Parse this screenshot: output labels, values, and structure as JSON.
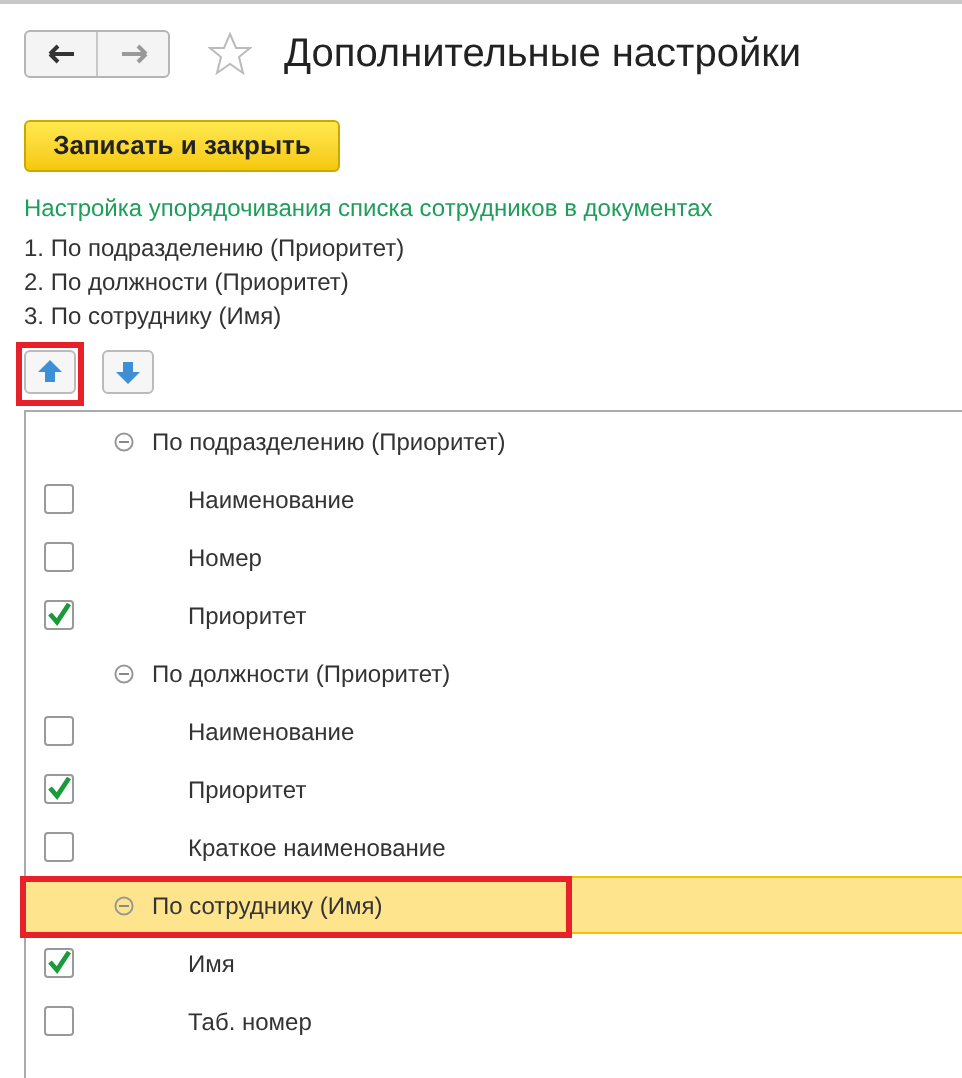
{
  "window": {
    "title": "Дополнительные настройки",
    "favorite": false
  },
  "toolbar": {
    "save_button": "Записать и закрыть"
  },
  "section_title": "Настройка упорядочивания списка сотрудников в документах",
  "order_lines": [
    "1. По подразделению (Приоритет)",
    "2. По должности (Приоритет)",
    "3. По сотруднику (Имя)"
  ],
  "move_buttons": [
    {
      "kind": "up",
      "highlighted": true
    },
    {
      "kind": "down",
      "highlighted": false
    }
  ],
  "tree": [
    {
      "label": "По подразделению (Приоритет)",
      "expanded": true,
      "selected": false,
      "highlighted": false,
      "children": [
        {
          "label": "Наименование",
          "checked": false
        },
        {
          "label": "Номер",
          "checked": false
        },
        {
          "label": "Приоритет",
          "checked": true
        }
      ]
    },
    {
      "label": "По должности (Приоритет)",
      "expanded": true,
      "selected": false,
      "highlighted": false,
      "children": [
        {
          "label": "Наименование",
          "checked": false
        },
        {
          "label": "Приоритет",
          "checked": true
        },
        {
          "label": "Краткое наименование",
          "checked": false
        }
      ]
    },
    {
      "label": "По сотруднику (Имя)",
      "expanded": true,
      "selected": true,
      "highlighted": true,
      "children": [
        {
          "label": "Имя",
          "checked": true
        },
        {
          "label": "Таб. номер",
          "checked": false
        }
      ]
    }
  ]
}
